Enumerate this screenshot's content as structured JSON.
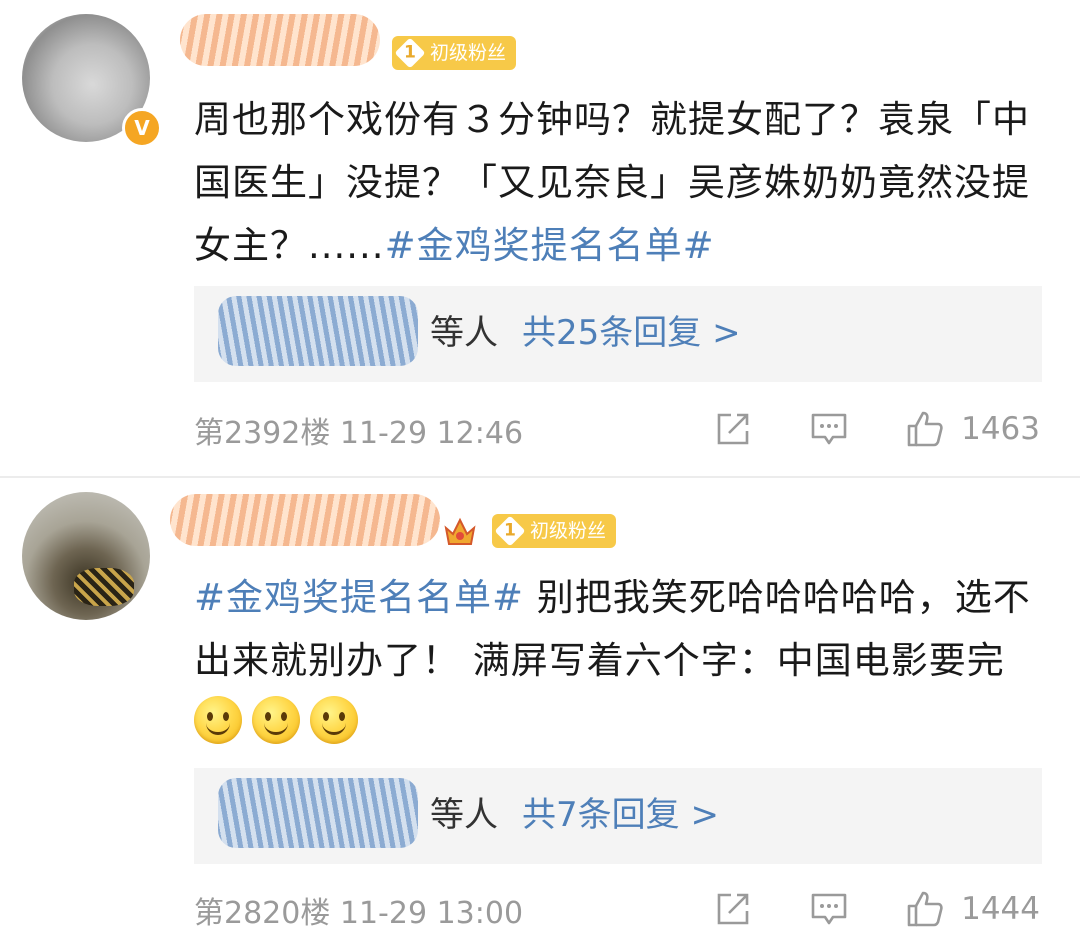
{
  "comments": [
    {
      "fan_badge": "初级粉丝",
      "fan_level": "1",
      "verified_mark": "V",
      "text_plain": "周也那个戏份有３分钟吗？就提女配了？袁泉「中国医生」没提？「又见奈良」吴彦姝奶奶竟然没提女主？......",
      "hashtag": "#金鸡奖提名名单#",
      "reply_people": "等人",
      "reply_link": "共25条回复 >",
      "floor_time": "第2392楼  11-29 12:46",
      "like_count": "1463"
    },
    {
      "fan_badge": "初级粉丝",
      "fan_level": "1",
      "hashtag": "#金鸡奖提名名单#",
      "text_plain": " 别把我笑死哈哈哈哈哈，选不出来就别办了！ 满屏写着六个字：中国电影要完",
      "emojis": [
        "smile-emoji",
        "smile-emoji",
        "smile-emoji"
      ],
      "reply_people": "等人",
      "reply_link": "共7条回复 >",
      "floor_time": "第2820楼  11-29 13:00",
      "like_count": "1444"
    }
  ],
  "icons": [
    "share-icon",
    "comment-icon",
    "thumbs-up-icon",
    "crown-icon",
    "verified-icon"
  ],
  "colors": {
    "link": "#4e7fb8",
    "badge": "#f7c948",
    "verified": "#f5a623",
    "meta": "#9a9a9a"
  }
}
